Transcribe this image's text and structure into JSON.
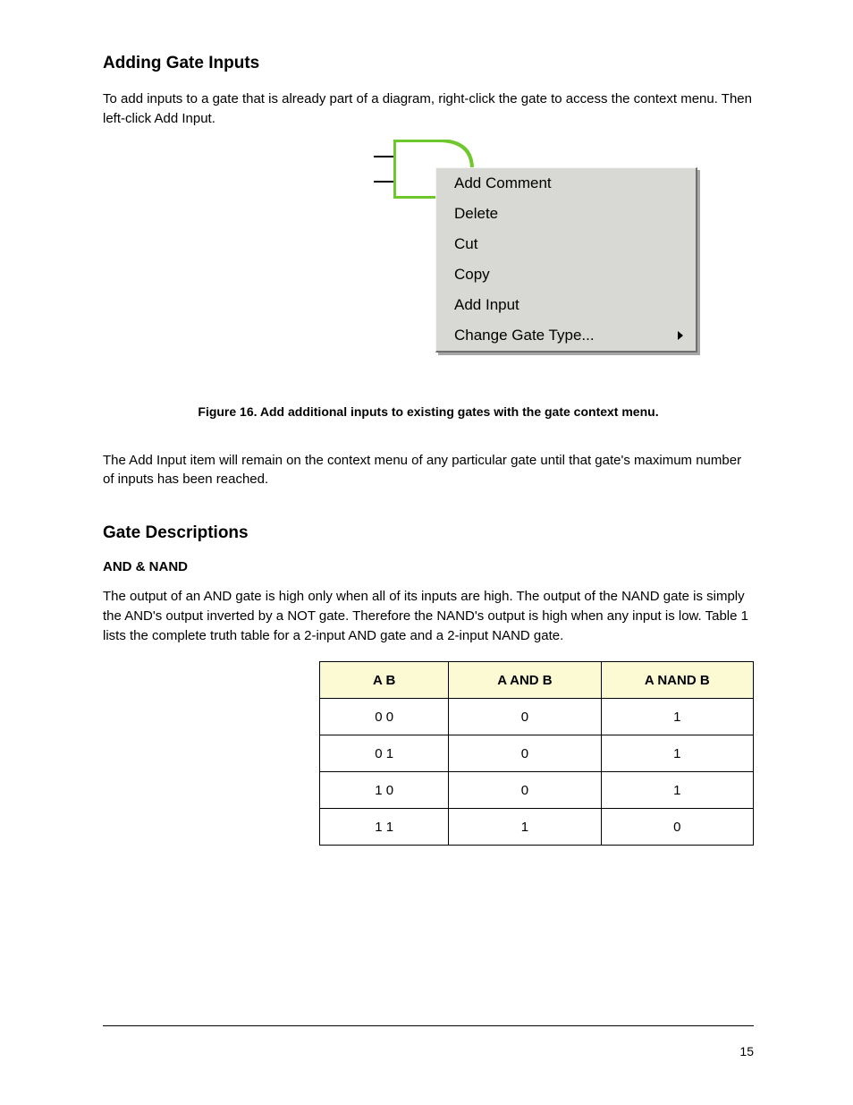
{
  "page": {
    "heading": "Adding Gate Inputs",
    "body1": "To add inputs to a gate that is already part of a diagram, right-click the gate to access the context menu. Then left-click Add Input.",
    "caption": "Figure 16. Add additional inputs to existing gates with the gate context menu.",
    "subnote": "The Add Input item will remain on the context menu of any particular gate until that gate's maximum number of inputs has been reached.",
    "section_heading": "Gate Descriptions",
    "gate_heading": "AND & NAND",
    "gate_desc": "The output of an AND gate is high only when all of its inputs are high. The output of the NAND gate is simply the AND's output inverted by a NOT gate. Therefore the NAND's output is high when any input is low. Table 1 lists the complete truth table for a 2-input AND gate and a 2-input NAND gate."
  },
  "context_menu": {
    "items": [
      {
        "label": "Add Comment",
        "has_submenu": false
      },
      {
        "label": "Delete",
        "has_submenu": false
      },
      {
        "label": "Cut",
        "has_submenu": false
      },
      {
        "label": "Copy",
        "has_submenu": false
      },
      {
        "label": "Add Input",
        "has_submenu": false
      },
      {
        "label": "Change Gate Type...",
        "has_submenu": true
      }
    ]
  },
  "chart_data": {
    "type": "table",
    "title": "2-input AND / NAND truth table",
    "columns": [
      "A B",
      "A AND B",
      "A NAND B"
    ],
    "rows": [
      [
        "0 0",
        "0",
        "1"
      ],
      [
        "0 1",
        "0",
        "1"
      ],
      [
        "1 0",
        "0",
        "1"
      ],
      [
        "1 1",
        "1",
        "0"
      ]
    ]
  },
  "footer": {
    "left": "",
    "right": "15"
  }
}
